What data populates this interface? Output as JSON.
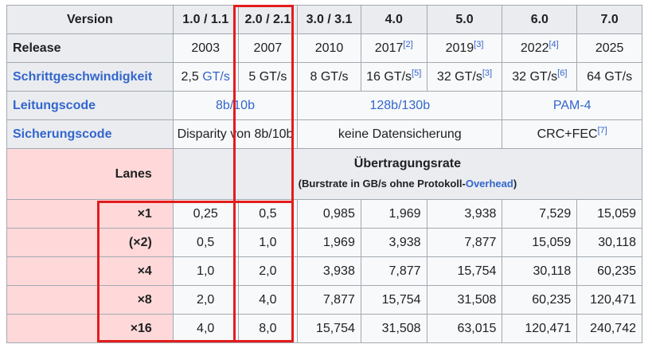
{
  "header": {
    "version_label": "Version",
    "columns": [
      "1.0 / 1.1",
      "2.0 / 2.1",
      "3.0 / 3.1",
      "4.0",
      "5.0",
      "6.0",
      "7.0"
    ]
  },
  "release": {
    "label": "Release",
    "values": [
      {
        "text": "2003",
        "ref": ""
      },
      {
        "text": "2007",
        "ref": ""
      },
      {
        "text": "2010",
        "ref": ""
      },
      {
        "text": "2017",
        "ref": "[2]"
      },
      {
        "text": "2019",
        "ref": "[3]"
      },
      {
        "text": "2022",
        "ref": "[4]"
      },
      {
        "text": "2025",
        "ref": ""
      }
    ]
  },
  "speed": {
    "label": "Schrittgeschwindigkeit",
    "values": [
      {
        "num": "2,5 ",
        "unit": "GT/s",
        "unit_link": true,
        "ref": ""
      },
      {
        "num": "5 GT/s",
        "unit": "",
        "unit_link": false,
        "ref": ""
      },
      {
        "num": "8 GT/s",
        "unit": "",
        "unit_link": false,
        "ref": ""
      },
      {
        "num": "16 GT/s",
        "unit": "",
        "unit_link": false,
        "ref": "[5]"
      },
      {
        "num": "32 GT/s",
        "unit": "",
        "unit_link": false,
        "ref": "[3]"
      },
      {
        "num": "32 GT/s",
        "unit": "",
        "unit_link": false,
        "ref": "[6]"
      },
      {
        "num": "64 GT/s",
        "unit": "",
        "unit_link": false,
        "ref": ""
      }
    ]
  },
  "line_code": {
    "label": "Leitungscode",
    "a": "8b/10b",
    "b": "128b/130b",
    "c": "PAM-4"
  },
  "protection": {
    "label": "Sicherungscode",
    "a": "Disparity von 8b/10b",
    "b": "keine Datensicherung",
    "c_text": "CRC+FEC",
    "c_ref": "[7]"
  },
  "rate": {
    "lanes_label": "Lanes",
    "title": "Übertragungsrate",
    "subtitle_pre": "(Burstrate in GB/s ohne Protokoll-",
    "subtitle_link": "Overhead",
    "subtitle_post": ")"
  },
  "lanes": [
    {
      "label": "×1",
      "values": [
        "0,25",
        "0,5",
        "0,985",
        "1,969",
        "3,938",
        "7,529",
        "15,059"
      ]
    },
    {
      "label": "(×2)",
      "values": [
        "0,5",
        "1,0",
        "1,969",
        "3,938",
        "7,877",
        "15,059",
        "30,118"
      ]
    },
    {
      "label": "×4",
      "values": [
        "1,0",
        "2,0",
        "3,938",
        "7,877",
        "15,754",
        "30,118",
        "60,235"
      ]
    },
    {
      "label": "×8",
      "values": [
        "2,0",
        "4,0",
        "7,877",
        "15,754",
        "31,508",
        "60,235",
        "120,471"
      ]
    },
    {
      "label": "×16",
      "values": [
        "4,0",
        "8,0",
        "15,754",
        "31,508",
        "63,015",
        "120,471",
        "240,742"
      ]
    }
  ],
  "highlight_color": "#e11d1d"
}
